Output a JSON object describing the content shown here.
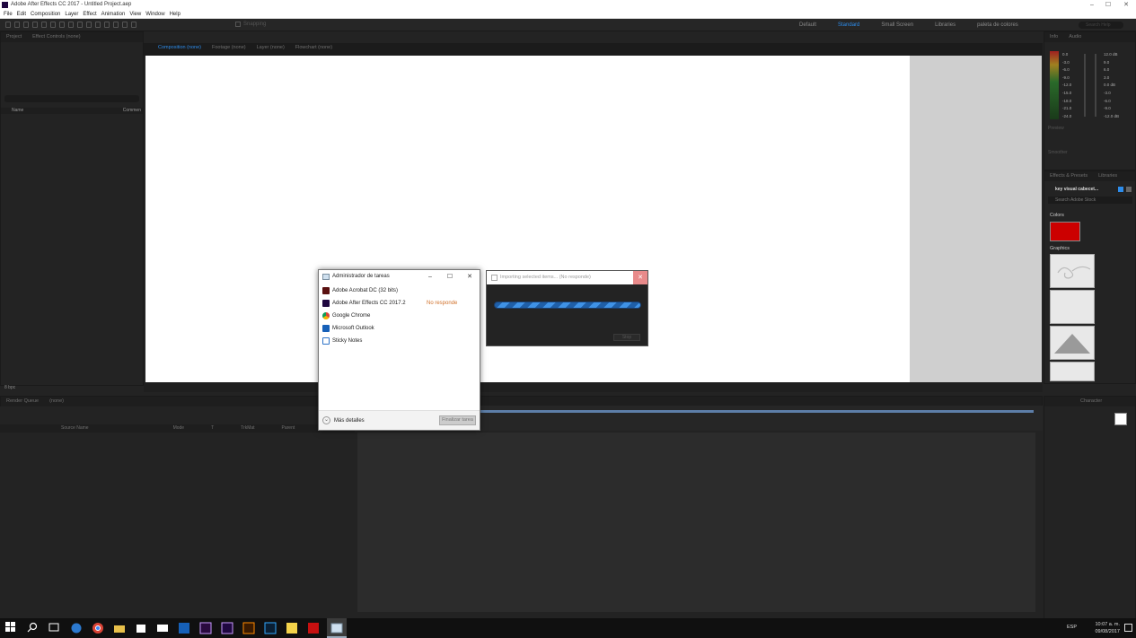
{
  "window": {
    "title": "Adobe After Effects CC 2017 - Untitled Project.aep"
  },
  "menu": [
    "File",
    "Edit",
    "Composition",
    "Layer",
    "Effect",
    "Animation",
    "View",
    "Window",
    "Help"
  ],
  "toolbar": {
    "snapping": "Snapping"
  },
  "workspaces": [
    {
      "label": "Default",
      "active": false
    },
    {
      "label": "Standard",
      "active": true
    },
    {
      "label": "Small Screen",
      "active": false
    },
    {
      "label": "Libraries",
      "active": false
    },
    {
      "label": "paleta de colores",
      "active": false
    }
  ],
  "search_help": "Search Help",
  "project_panel": {
    "tabs": [
      "Project",
      "Effect Controls (none)"
    ],
    "col_name": "Name",
    "col_comment": "Commen",
    "bpc": "8 bpc"
  },
  "viewer": {
    "tabs": [
      "Composition (none)",
      "Footage (none)",
      "Layer (none)",
      "Flowchart (none)"
    ]
  },
  "timeline": {
    "tabs": [
      "Render Queue",
      "(none)"
    ],
    "cols": [
      "Source Name",
      "Mode",
      "T",
      "TrkMat",
      "Parent"
    ]
  },
  "right_panels": {
    "info": "Info",
    "audio": "Audio",
    "preview": "Preview",
    "smoother": "Smoother",
    "effects": "Effects & Presets",
    "libraries": "Libraries",
    "library_name": "key visual cabecet...",
    "search_stock": "Search Adobe Stock",
    "colors_label": "Colors",
    "graphics_label": "Graphics",
    "character": "Character",
    "color_red": "#cc0000",
    "audio_levels_left": [
      "0.0",
      "-3.0",
      "-6.0",
      "-9.0",
      "-12.0",
      "-15.0",
      "-18.0",
      "-21.0",
      "-24.0"
    ],
    "audio_levels_right": [
      "12.0 dB",
      "9.0",
      "6.0",
      "3.0",
      "0.0 dB",
      "-3.0",
      "-6.0",
      "-9.0",
      "-12.0 dB"
    ]
  },
  "task_manager": {
    "title": "Administrador de tareas",
    "apps": [
      {
        "name": "Adobe Acrobat DC (32 bits)",
        "status": "",
        "icon": "acrobat-icon",
        "color": "#5a1010"
      },
      {
        "name": "Adobe After Effects CC 2017.2",
        "status": "No responde",
        "icon": "after-effects-icon",
        "color": "#1f0740"
      },
      {
        "name": "Google Chrome",
        "status": "",
        "icon": "chrome-icon",
        "color": "#e8a030"
      },
      {
        "name": "Microsoft Outlook",
        "status": "",
        "icon": "outlook-icon",
        "color": "#1660b8"
      },
      {
        "name": "Sticky Notes",
        "status": "",
        "icon": "sticky-notes-icon",
        "color": "#2c72c7"
      }
    ],
    "more_details": "Más detalles",
    "end_task": "Finalizar tarea"
  },
  "import_dialog": {
    "title": "Importing selected items... (No responde)",
    "stop": "Stop"
  },
  "taskbar": {
    "lang": "ESP",
    "time": "10:07 a. m.",
    "date": "09/08/2017"
  }
}
